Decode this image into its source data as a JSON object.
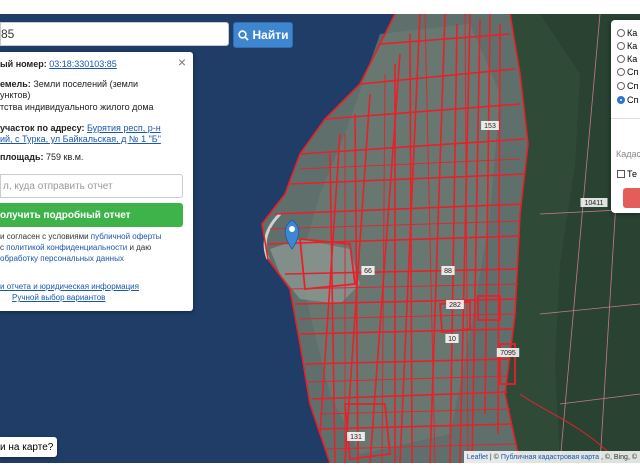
{
  "search": {
    "value": "85",
    "button_label": "Найти"
  },
  "info": {
    "close": "×",
    "cadastral_prefix": "ый номер: ",
    "cadastral_number": "03:18:330103:85",
    "category_line1_prefix": "емель: ",
    "category_line1_value": "Земли поселений (земли",
    "category_line2": "унктов)",
    "use_line": "тства индивидуального жилого дома",
    "address_prefix": "участок по адресу: ",
    "address_line1": "Бурятия респ, р-н",
    "address_line2": "ий, с Турка, ул Байкальская, д № 1 \"Б\"",
    "area_prefix": "площадь: ",
    "area_value": "759 кв.м.",
    "email_placeholder": "л, куда отправить отчет",
    "report_button": "олучить подробный отчет",
    "consent_line1_prefix": "и согласен с условиями ",
    "consent_link1": "публичной оферты",
    "consent_line2_prefix": "с ",
    "consent_link2": "политикой конфиденциальности",
    "consent_line2_suffix": " и даю",
    "consent_link3": "обработку персональных данных",
    "link_more": "и отчета и юридическая информация",
    "link_manual": "Ручной выбор вариантов"
  },
  "layers": {
    "options": [
      "Ка",
      "Ка",
      "Ка",
      "Сп",
      "Сп",
      "Сп"
    ],
    "selected_index": 5,
    "cadastre_label": "Кадас",
    "checkbox_label": "Те"
  },
  "map": {
    "parcel_labels": [
      "153",
      "66",
      "282",
      "10",
      "7095",
      "131",
      "10411",
      "88"
    ],
    "colors": {
      "parcel_line": "#e8202a",
      "water": "#1f3d66",
      "forest": "#2e4a37",
      "land": "#5a6e6a",
      "marker": "#3f86d0",
      "report_green": "#3eb34a",
      "search_blue": "#3f86d0"
    }
  },
  "bottom": {
    "label": "и на карте?"
  },
  "attribution": {
    "leaflet": "Leaflet",
    "sep": " | © ",
    "source": "Публичная кадастровая карта",
    "rest": ", ©, Bing, ©"
  }
}
